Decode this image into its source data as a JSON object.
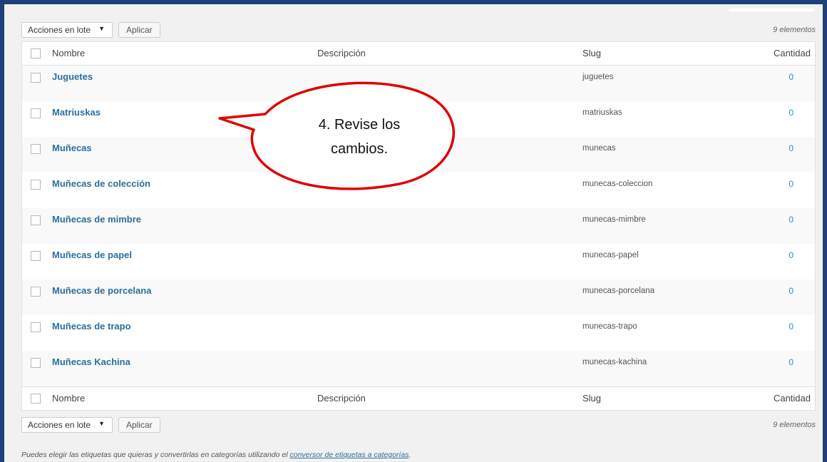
{
  "toolbar_top": {
    "bulk_actions": "Acciones en lote",
    "apply": "Aplicar",
    "count": "9 elementos"
  },
  "toolbar_bottom": {
    "bulk_actions": "Acciones en lote",
    "apply": "Aplicar",
    "count": "9 elementos"
  },
  "columns": {
    "name": "Nombre",
    "description": "Descripción",
    "slug": "Slug",
    "count": "Cantidad"
  },
  "rows": [
    {
      "name": "Juguetes",
      "slug": "juguetes",
      "count": "0"
    },
    {
      "name": "Matriuskas",
      "slug": "matriuskas",
      "count": "0"
    },
    {
      "name": "Muñecas",
      "slug": "munecas",
      "count": "0"
    },
    {
      "name": "Muñecas de colección",
      "slug": "munecas-coleccion",
      "count": "0"
    },
    {
      "name": "Muñecas de mimbre",
      "slug": "munecas-mimbre",
      "count": "0"
    },
    {
      "name": "Muñecas de papel",
      "slug": "munecas-papel",
      "count": "0"
    },
    {
      "name": "Muñecas de porcelana",
      "slug": "munecas-porcelana",
      "count": "0"
    },
    {
      "name": "Muñecas de trapo",
      "slug": "munecas-trapo",
      "count": "0"
    },
    {
      "name": "Muñecas Kachina",
      "slug": "munecas-kachina",
      "count": "0"
    }
  ],
  "footnote": {
    "text": "Puedes elegir las etiquetas que quieras y convertirlas en categorías utilizando el ",
    "link": "conversor de etiquetas a categorías",
    "end": "."
  },
  "callout": {
    "line1": "4. Revise los",
    "line2": "cambios."
  },
  "colors": {
    "frame": "#1e3f78",
    "link": "#2a6fa0",
    "callout_border": "#e00000"
  }
}
